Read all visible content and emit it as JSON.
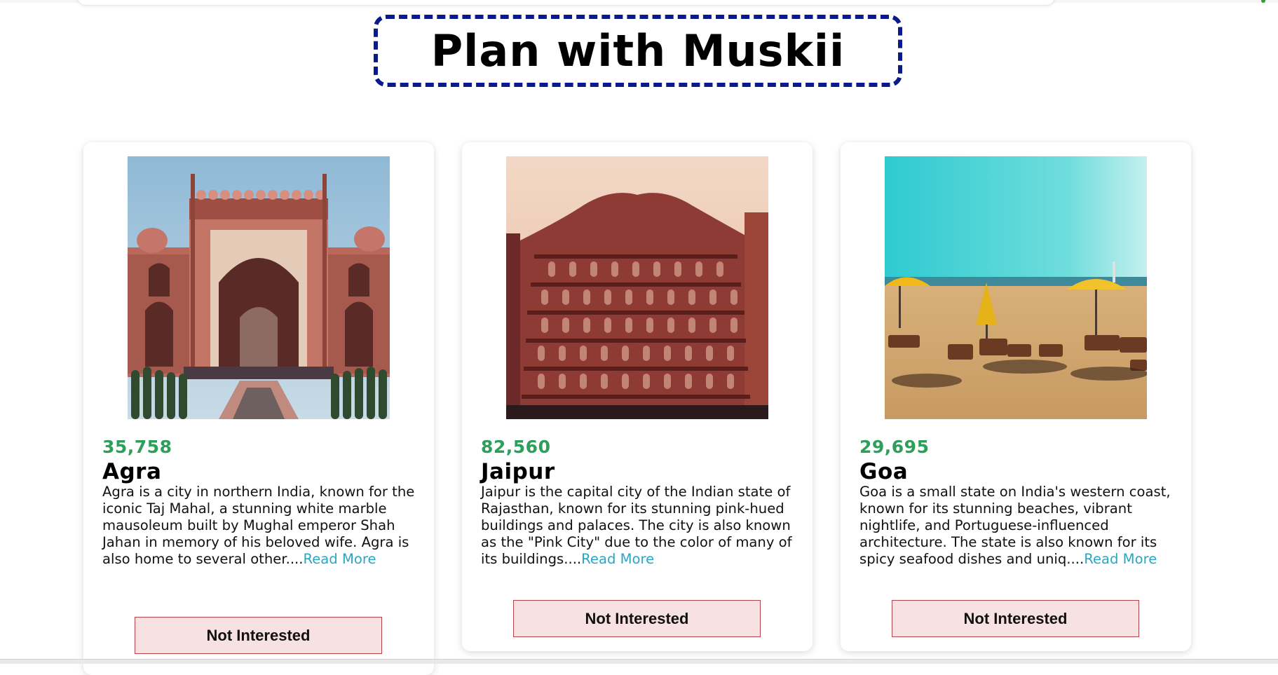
{
  "page": {
    "title": "Plan with Muskii"
  },
  "colors": {
    "title_border": "#0a1a8c",
    "visitor_count": "#2e9e5b",
    "read_more_link": "#2aa6c4",
    "button_bg": "#f7e1e3",
    "button_border": "#b3444b"
  },
  "cards": [
    {
      "visitors": "35,758",
      "city": "Agra",
      "description": "Agra is a city in northern India, known for the iconic Taj Mahal, a stunning white marble mausoleum built by Mughal emperor Shah Jahan in memory of his beloved wife. Agra is also home to several other....",
      "read_more": "Read More",
      "button": "Not Interested",
      "image_icon": "taj-mahal-gate-photo"
    },
    {
      "visitors": "82,560",
      "city": "Jaipur",
      "description": "Jaipur is the capital city of the Indian state of Rajasthan, known for its stunning pink-hued buildings and palaces. The city is also known as the \"Pink City\" due to the color of many of its buildings....",
      "read_more": "Read More",
      "button": "Not Interested",
      "image_icon": "hawa-mahal-photo"
    },
    {
      "visitors": "29,695",
      "city": "Goa",
      "description": "Goa is a small state on India's western coast, known for its stunning beaches, vibrant nightlife, and Portuguese-influenced architecture. The state is also known for its spicy seafood dishes and uniq....",
      "read_more": "Read More",
      "button": "Not Interested",
      "image_icon": "beach-umbrellas-photo"
    }
  ]
}
